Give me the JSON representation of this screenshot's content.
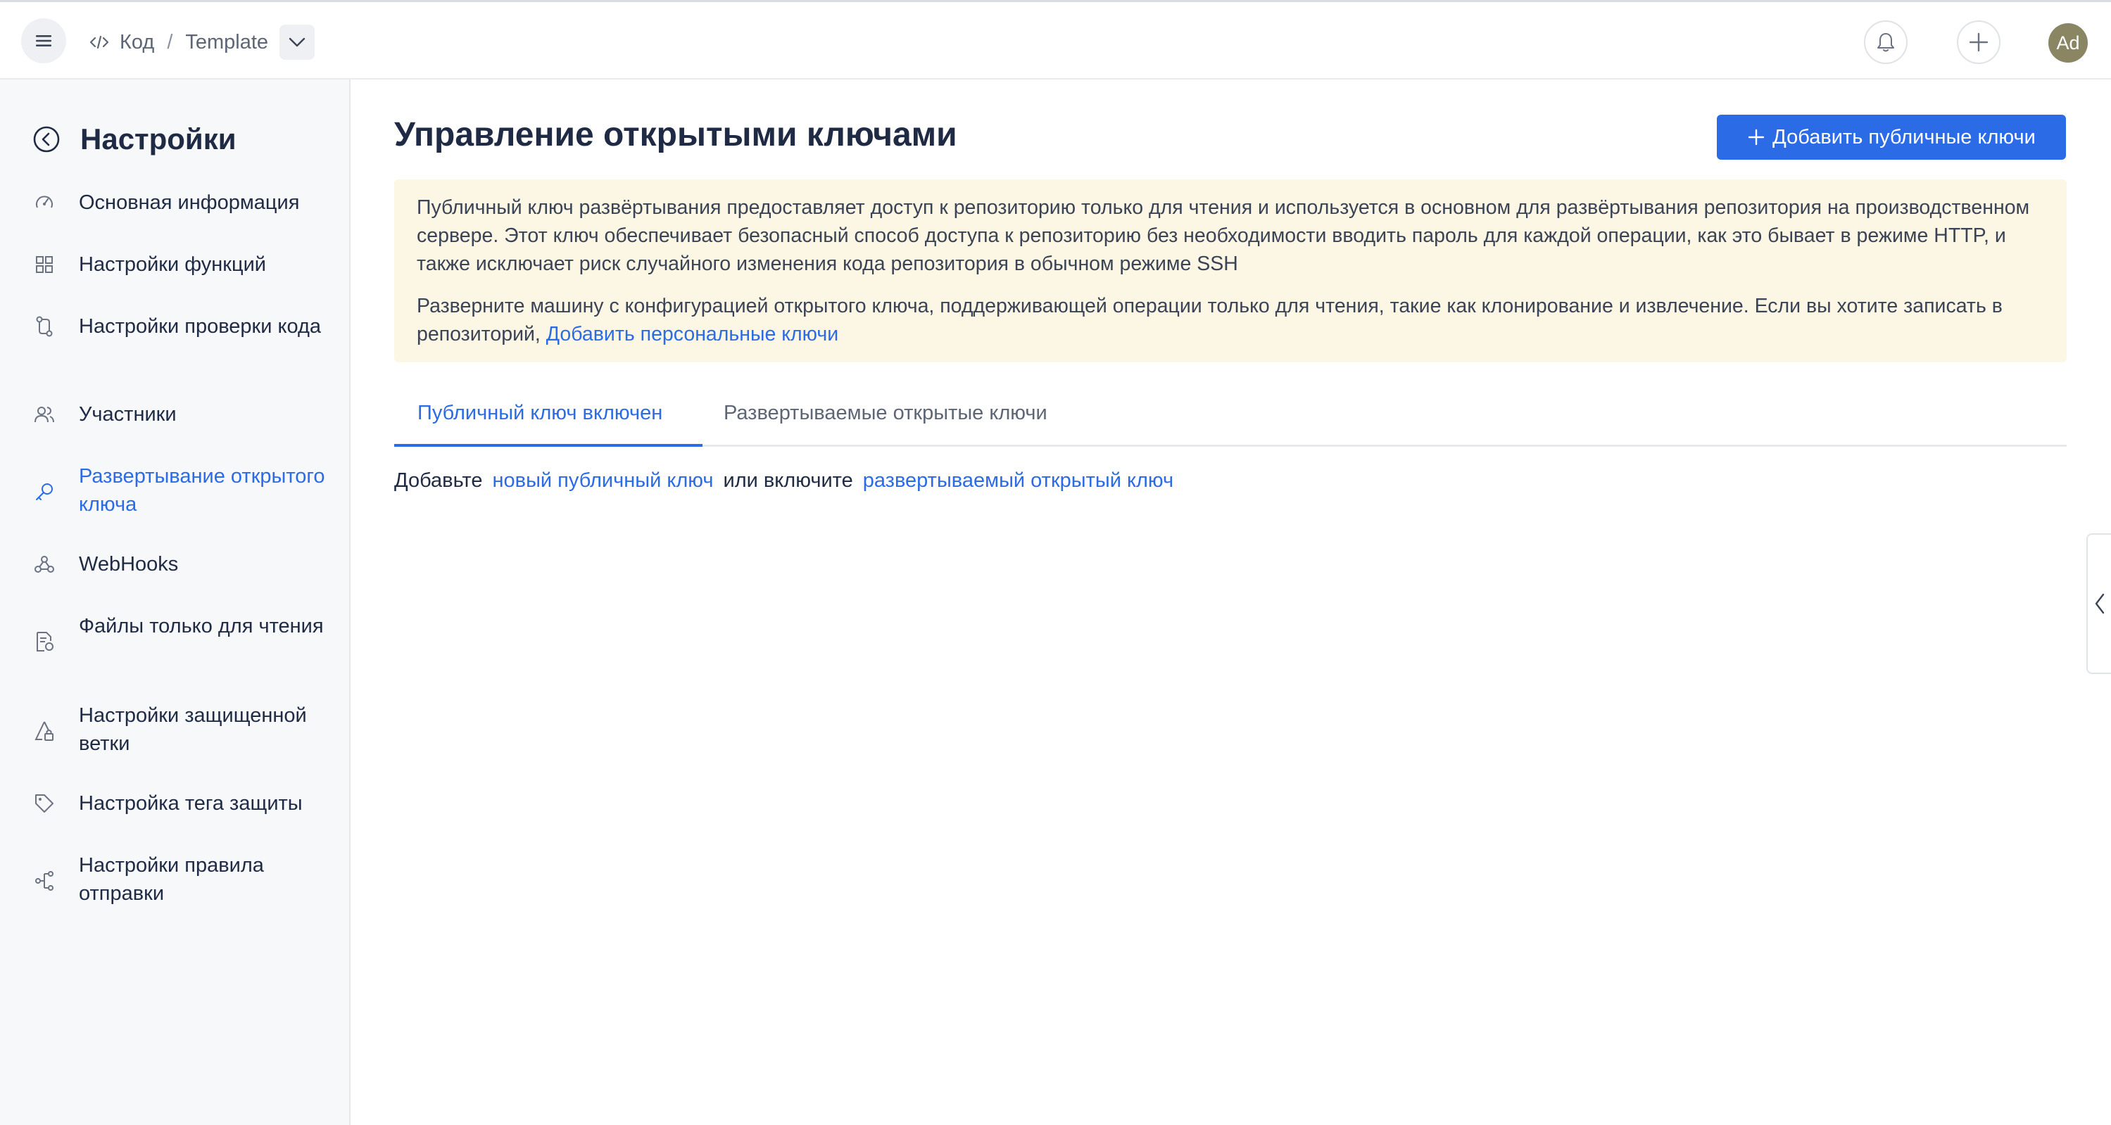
{
  "header": {
    "breadcrumb": [
      "Код",
      "Template"
    ],
    "avatar_initials": "Ad"
  },
  "sidebar": {
    "title": "Настройки",
    "items": [
      {
        "label": "Основная информация",
        "icon": "speedometer-icon",
        "active": false
      },
      {
        "label": "Настройки функций",
        "icon": "grid-icon",
        "active": false
      },
      {
        "label": "Настройки проверки кода",
        "icon": "git-compare-icon",
        "active": false
      },
      {
        "label": "Участники",
        "icon": "users-icon",
        "active": false
      },
      {
        "label": "Развертывание открытого ключа",
        "icon": "key-icon",
        "active": true
      },
      {
        "label": "WebHooks",
        "icon": "webhook-icon",
        "active": false
      },
      {
        "label": "Файлы только для чтения",
        "icon": "file-lock-icon",
        "active": false
      },
      {
        "label": "Настройки защищенной ветки",
        "icon": "branch-lock-icon",
        "active": false
      },
      {
        "label": "Настройка тега защиты",
        "icon": "tag-icon",
        "active": false
      },
      {
        "label": "Настройки правила отправки",
        "icon": "push-rule-icon",
        "active": false
      }
    ]
  },
  "main": {
    "title": "Управление открытыми ключами",
    "add_button": "Добавить публичные ключи",
    "notice": {
      "paragraph1": "Публичный ключ развёртывания предоставляет доступ к репозиторию только для чтения и используется в основном для развёртывания репозитория на производственном сервере. Этот ключ обеспечивает безопасный способ доступа к репозиторию без необходимости вводить пароль для каждой операции, как это бывает в режиме HTTP, и также исключает риск случайного изменения кода репозитория в обычном режиме SSH",
      "paragraph2": "Разверните машину с конфигурацией открытого ключа, поддерживающей операции только для чтения, такие как клонирование и извлечение. Если вы хотите записать в репозиторий,",
      "link": "Добавить персональные ключи"
    },
    "tabs": [
      "Публичный ключ включен",
      "Развертываемые открытые ключи"
    ],
    "empty_state": {
      "prefix": "Добавьте",
      "link1": "новый публичный ключ",
      "middle": "или включите",
      "link2": "развертываемый открытый ключ"
    }
  },
  "colors": {
    "accent": "#2b6be6",
    "notice_bg": "#fcf7e4",
    "sidebar_bg": "#f7f8fa",
    "avatar_bg": "#8a8663"
  }
}
